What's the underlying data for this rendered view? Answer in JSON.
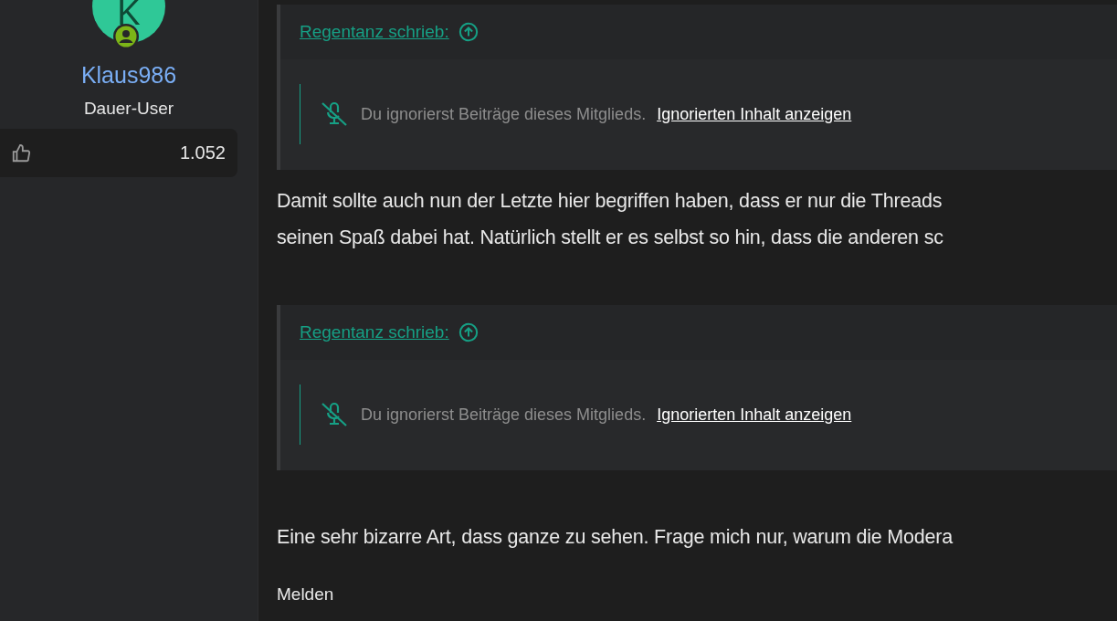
{
  "author": {
    "avatar_letter": "K",
    "name": "Klaus986",
    "title": "Dauer-User",
    "reactions": "1.052"
  },
  "content": [
    {
      "kind": "quote",
      "author_link": "Regentanz schrieb:",
      "notice": "Du ignorierst Beiträge dieses Mitglieds.",
      "show_link": "Ignorierten Inhalt anzeigen"
    },
    {
      "kind": "text",
      "lines": [
        "Damit sollte auch nun der Letzte hier begriffen haben, dass er nur die Threads",
        "seinen Spaß dabei hat. Natürlich stellt er es selbst so hin, dass die anderen sc"
      ]
    },
    {
      "kind": "quote",
      "author_link": "Regentanz schrieb:",
      "notice": "Du ignorierst Beiträge dieses Mitglieds.",
      "show_link": "Ignorierten Inhalt anzeigen"
    },
    {
      "kind": "text",
      "lines": [
        "Eine sehr bizarre Art, dass ganze zu sehen. Frage mich nur, warum die Modera"
      ]
    }
  ],
  "report_link": "Melden"
}
